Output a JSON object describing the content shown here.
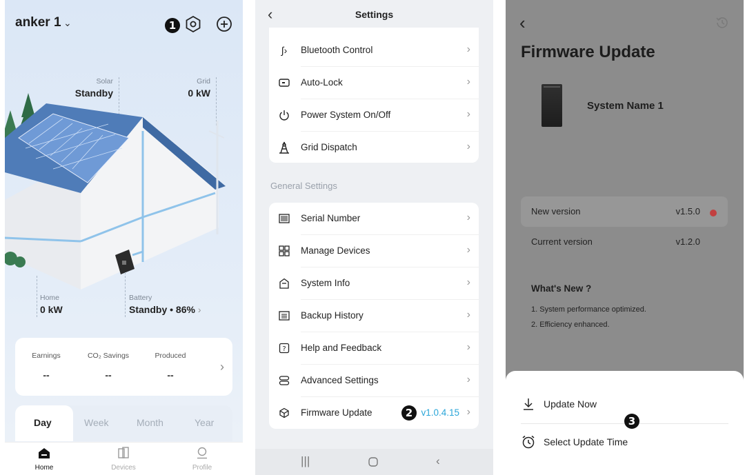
{
  "home": {
    "station_name": "anker 1",
    "badge": "1",
    "solar": {
      "label": "Solar",
      "value": "Standby"
    },
    "grid": {
      "label": "Grid",
      "value": "0 kW"
    },
    "home_stat": {
      "label": "Home",
      "value": "0 kW"
    },
    "battery": {
      "label": "Battery",
      "value": "Standby • 86%"
    },
    "stats": [
      {
        "label": "Earnings",
        "value": "--"
      },
      {
        "label": "CO₂ Savings",
        "value": "--"
      },
      {
        "label": "Produced",
        "value": "--"
      }
    ],
    "periods": [
      "Day",
      "Week",
      "Month",
      "Year"
    ],
    "tabs": [
      {
        "label": "Home",
        "icon": "home-icon"
      },
      {
        "label": "Devices",
        "icon": "devices-icon"
      },
      {
        "label": "Profile",
        "icon": "profile-icon"
      }
    ]
  },
  "settings": {
    "title": "Settings",
    "top_items": [
      {
        "label": "Bluetooth Control",
        "icon": "bluetooth-icon"
      },
      {
        "label": "Auto-Lock",
        "icon": "lock-icon"
      },
      {
        "label": "Power System On/Off",
        "icon": "power-icon"
      },
      {
        "label": "Grid Dispatch",
        "icon": "tower-icon"
      }
    ],
    "section_title": "General Settings",
    "general_items": [
      {
        "label": "Serial Number",
        "icon": "barcode-icon"
      },
      {
        "label": "Manage Devices",
        "icon": "grid-icon"
      },
      {
        "label": "System Info",
        "icon": "home-info-icon"
      },
      {
        "label": "Backup History",
        "icon": "list-icon"
      },
      {
        "label": "Help and Feedback",
        "icon": "help-icon"
      },
      {
        "label": "Advanced Settings",
        "icon": "advanced-icon"
      },
      {
        "label": "Firmware Update",
        "icon": "cube-icon",
        "value": "v1.0.4.15"
      }
    ],
    "badge": "2",
    "accent_color": "#2aa6d9"
  },
  "firmware": {
    "title": "Firmware Update",
    "device_name": "System Name 1",
    "new_version": {
      "label": "New version",
      "value": "v1.5.0"
    },
    "current_version": {
      "label": "Current version",
      "value": "v1.2.0"
    },
    "whats_new_title": "What's New ?",
    "whats_new": [
      "1. System performance optimized.",
      "2. Efficiency enhanced."
    ],
    "actions": [
      {
        "label": "Update Now",
        "icon": "download-icon"
      },
      {
        "label": "Select Update Time",
        "icon": "alarm-icon"
      }
    ],
    "badge": "3",
    "dot_color": "#c24040"
  }
}
